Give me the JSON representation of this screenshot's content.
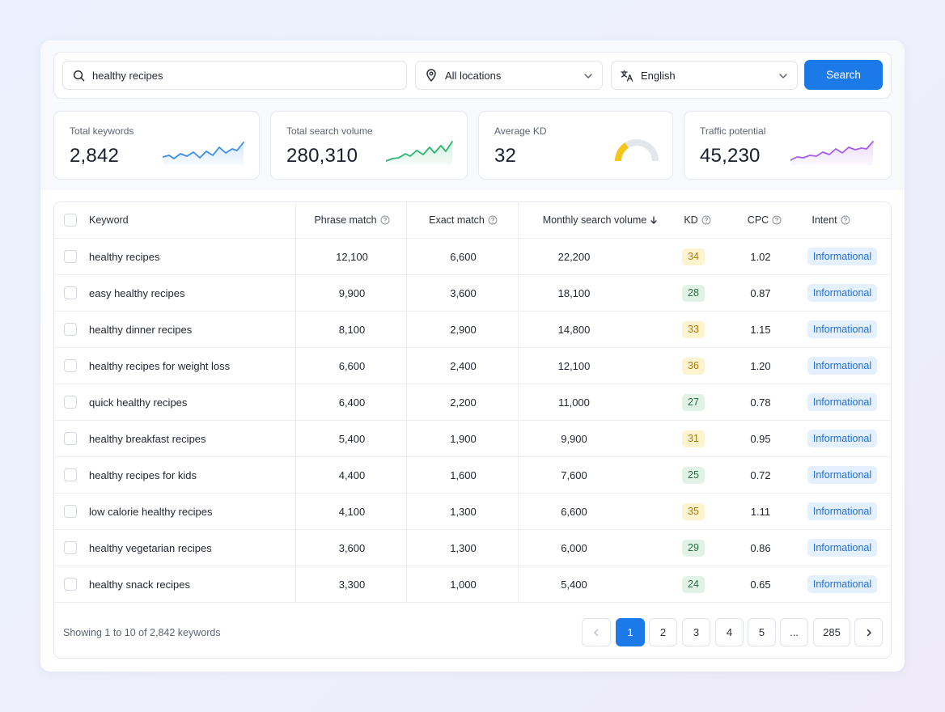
{
  "search": {
    "keyword_value": "healthy recipes",
    "location_value": "All locations",
    "language_value": "English",
    "search_button": "Search"
  },
  "stats": [
    {
      "label": "Total keywords",
      "value": "2,842",
      "color": "#3b8ee8"
    },
    {
      "label": "Total search volume",
      "value": "280,310",
      "color": "#2bb673"
    },
    {
      "label": "Average KD",
      "value": "32",
      "gauge_fraction": 0.32,
      "color": "#f5c518"
    },
    {
      "label": "Traffic potential",
      "value": "45,230",
      "color": "#a35ee6"
    }
  ],
  "table": {
    "columns": {
      "keyword": "Keyword",
      "phrase_match": "Phrase match",
      "exact_match": "Exact match",
      "monthly_volume": "Monthly search volume",
      "kd": "KD",
      "cpc": "CPC",
      "intent": "Intent"
    },
    "rows": [
      {
        "keyword": "healthy recipes",
        "phrase": "12,100",
        "exact": "6,600",
        "volume": "22,200",
        "kd": "34",
        "kd_level": "mid",
        "cpc": "1.02",
        "intent": "Informational"
      },
      {
        "keyword": "easy healthy recipes",
        "phrase": "9,900",
        "exact": "3,600",
        "volume": "18,100",
        "kd": "28",
        "kd_level": "low",
        "cpc": "0.87",
        "intent": "Informational"
      },
      {
        "keyword": "healthy dinner recipes",
        "phrase": "8,100",
        "exact": "2,900",
        "volume": "14,800",
        "kd": "33",
        "kd_level": "mid",
        "cpc": "1.15",
        "intent": "Informational"
      },
      {
        "keyword": "healthy recipes for weight loss",
        "phrase": "6,600",
        "exact": "2,400",
        "volume": "12,100",
        "kd": "36",
        "kd_level": "mid",
        "cpc": "1.20",
        "intent": "Informational"
      },
      {
        "keyword": "quick healthy recipes",
        "phrase": "6,400",
        "exact": "2,200",
        "volume": "11,000",
        "kd": "27",
        "kd_level": "low",
        "cpc": "0.78",
        "intent": "Informational"
      },
      {
        "keyword": "healthy breakfast recipes",
        "phrase": "5,400",
        "exact": "1,900",
        "volume": "9,900",
        "kd": "31",
        "kd_level": "mid",
        "cpc": "0.95",
        "intent": "Informational"
      },
      {
        "keyword": "healthy recipes for kids",
        "phrase": "4,400",
        "exact": "1,600",
        "volume": "7,600",
        "kd": "25",
        "kd_level": "low",
        "cpc": "0.72",
        "intent": "Informational"
      },
      {
        "keyword": "low calorie healthy recipes",
        "phrase": "4,100",
        "exact": "1,300",
        "volume": "6,600",
        "kd": "35",
        "kd_level": "mid",
        "cpc": "1.11",
        "intent": "Informational"
      },
      {
        "keyword": "healthy vegetarian recipes",
        "phrase": "3,600",
        "exact": "1,300",
        "volume": "6,000",
        "kd": "29",
        "kd_level": "low",
        "cpc": "0.86",
        "intent": "Informational"
      },
      {
        "keyword": "healthy snack recipes",
        "phrase": "3,300",
        "exact": "1,000",
        "volume": "5,400",
        "kd": "24",
        "kd_level": "low",
        "cpc": "0.65",
        "intent": "Informational"
      }
    ]
  },
  "pagination": {
    "summary": "Showing 1 to 10 of 2,842 keywords",
    "pages": [
      "1",
      "2",
      "3",
      "4",
      "5",
      "...",
      "285"
    ],
    "current": "1"
  }
}
